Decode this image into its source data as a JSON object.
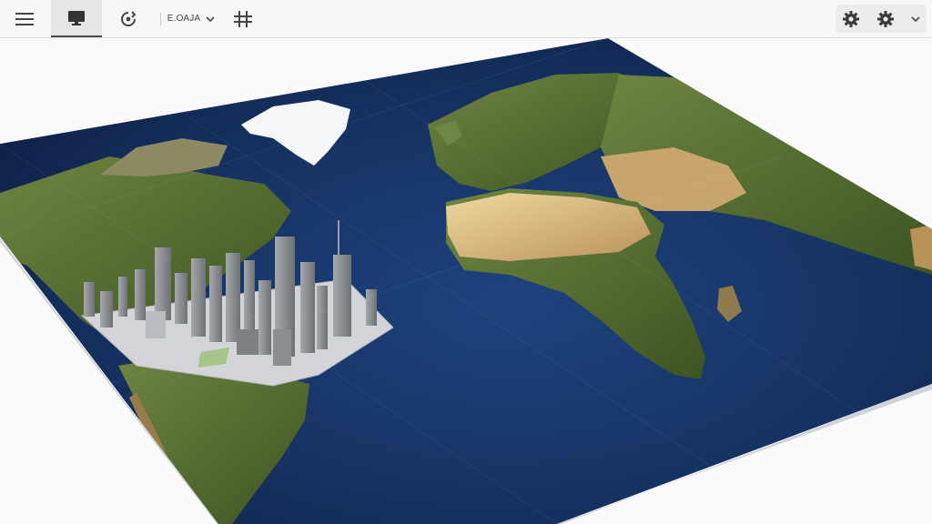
{
  "toolbar": {
    "menu_icon": "hamburger-menu-icon",
    "display_icon": "monitor-icon",
    "rotate_icon": "rotate-icon",
    "view_label": "Е.ОАЈА",
    "view_chevron_icon": "chevron-down-icon",
    "grid_icon": "grid-icon",
    "settings_icon_1": "gear-icon",
    "settings_icon_2": "gear-icon",
    "settings_chevron_icon": "chevron-down-icon"
  },
  "colors": {
    "ocean_deep": "#0f2147",
    "ocean_mid": "#1d3f78",
    "land_green": "#4e6a2c",
    "desert": "#d9b77a",
    "ice": "#f4f6f8",
    "city": "#8e9196"
  }
}
